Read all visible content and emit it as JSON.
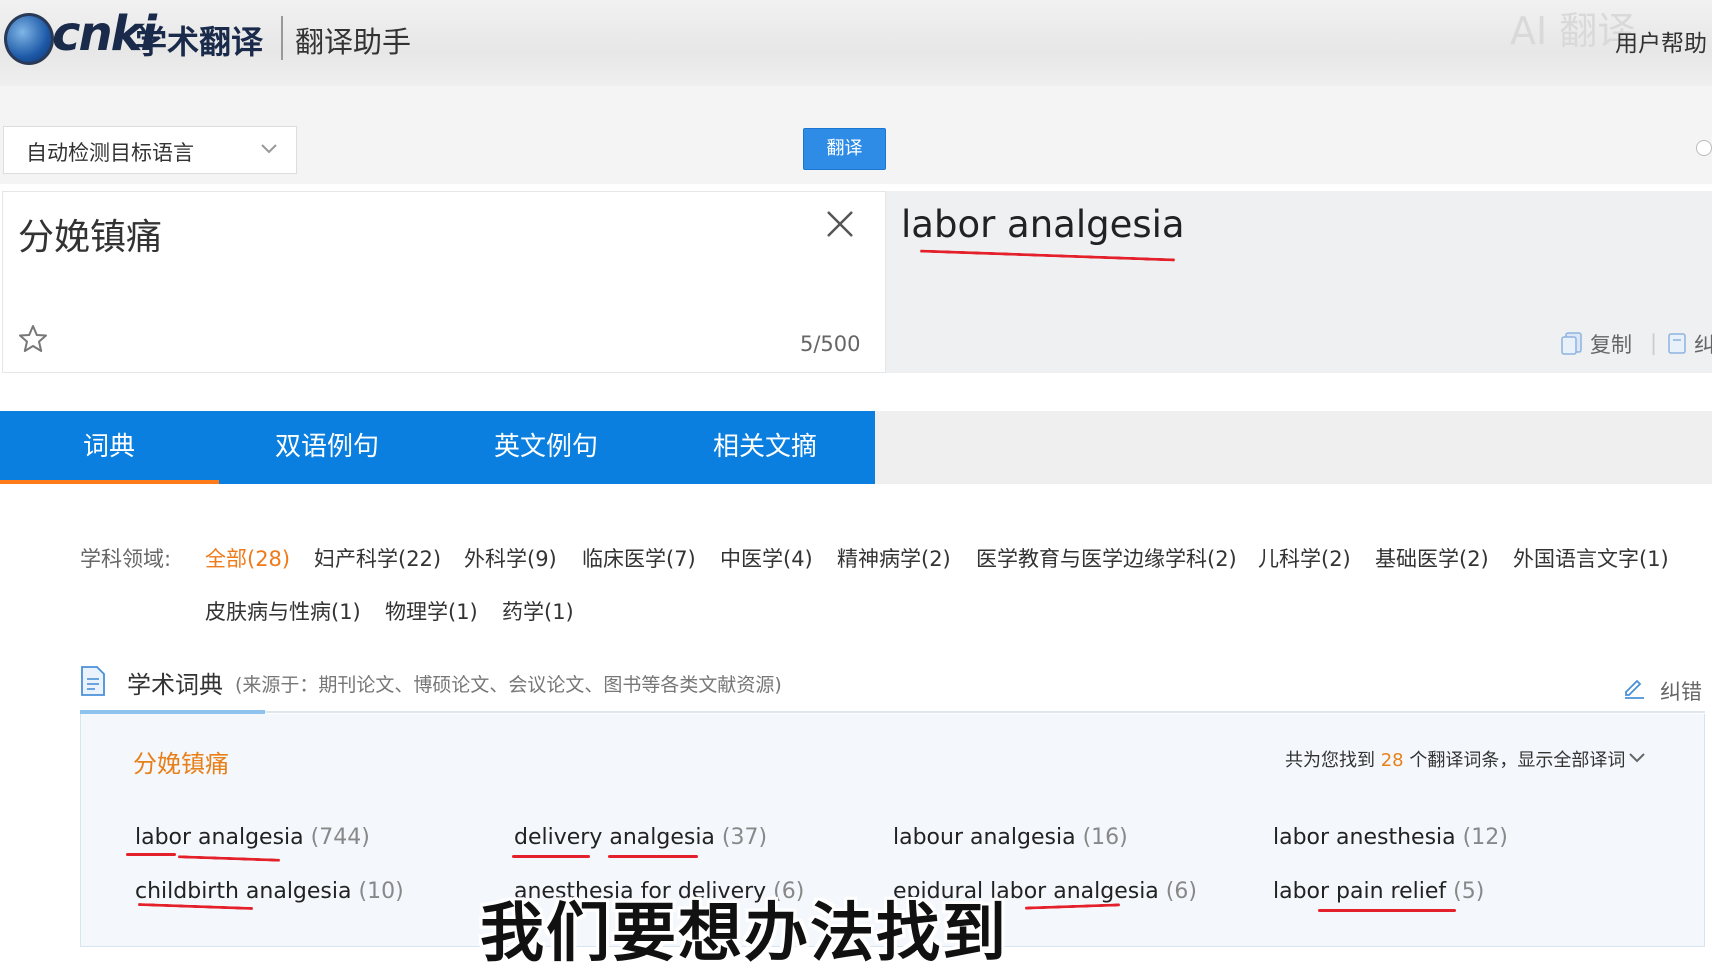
{
  "header": {
    "logo_text": "cnki",
    "logo_cn": "学术翻译",
    "subtitle": "翻译助手",
    "help_link": "用户帮助",
    "ghost_text": "AI 翻译"
  },
  "controls": {
    "language_select": "自动检测目标语言",
    "translate_button": "翻译"
  },
  "source": {
    "text": "分娩镇痛",
    "char_count": "5/500"
  },
  "target": {
    "text": "labor analgesia",
    "copy_label": "复制",
    "edit_label": "纠",
    "separator": "|"
  },
  "tabs": [
    {
      "label": "词典",
      "active": true
    },
    {
      "label": "双语例句",
      "active": false
    },
    {
      "label": "英文例句",
      "active": false
    },
    {
      "label": "相关文摘",
      "active": false
    }
  ],
  "subjects": {
    "label": "学科领域:",
    "items": [
      {
        "label": "全部(28)",
        "active": true
      },
      {
        "label": "妇产科学(22)"
      },
      {
        "label": "外科学(9)"
      },
      {
        "label": "临床医学(7)"
      },
      {
        "label": "中医学(4)"
      },
      {
        "label": "精神病学(2)"
      },
      {
        "label": "医学教育与医学边缘学科(2)"
      },
      {
        "label": "儿科学(2)"
      },
      {
        "label": "基础医学(2)"
      },
      {
        "label": "外国语言文字(1)"
      },
      {
        "label": "皮肤病与性病(1)"
      },
      {
        "label": "物理学(1)"
      },
      {
        "label": "药学(1)"
      }
    ]
  },
  "dictionary": {
    "title": "学术词典",
    "source_note": "(来源于：期刊论文、博硕论文、会议论文、图书等各类文献资源)",
    "correct_label": "纠错",
    "term": "分娩镇痛",
    "result_prefix": "共为您找到",
    "result_count": "28",
    "result_suffix": "个翻译词条，显示全部译词",
    "translations": [
      {
        "text": "labor analgesia",
        "count": "(744)"
      },
      {
        "text": "delivery analgesia",
        "count": "(37)"
      },
      {
        "text": "labour analgesia",
        "count": "(16)"
      },
      {
        "text": "labor anesthesia",
        "count": "(12)"
      },
      {
        "text": "childbirth analgesia",
        "count": "(10)"
      },
      {
        "text": "anesthesia for delivery",
        "count": "(6)"
      },
      {
        "text": "epidural labor analgesia",
        "count": "(6)"
      },
      {
        "text": "labor pain relief",
        "count": "(5)"
      }
    ]
  },
  "overlay": {
    "subtitle": "我们要想办法找到"
  }
}
